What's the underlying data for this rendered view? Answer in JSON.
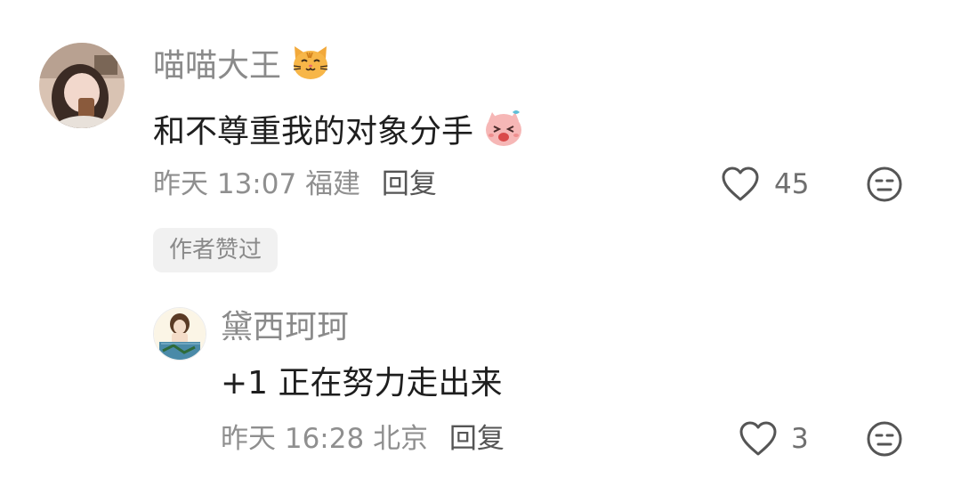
{
  "comment": {
    "username": "喵喵大王",
    "username_emoji": "cat-face-emoji",
    "text": "和不尊重我的对象分手",
    "text_emoji": "crying-face-sticker",
    "time": "昨天 13:07",
    "location": "福建",
    "reply_label": "回复",
    "like_count": "45",
    "author_badge": "作者赞过"
  },
  "reply": {
    "username": "黛西珂珂",
    "text": "+1 正在努力走出来",
    "time": "昨天 16:28",
    "location": "北京",
    "reply_label": "回复",
    "like_count": "3"
  },
  "icons": {
    "like": "heart-outline-icon",
    "dislike": "expressionless-face-icon"
  },
  "colors": {
    "username": "#8a8a8a",
    "text": "#1e1e1e",
    "meta": "#8f8f8f",
    "badge_bg": "#f1f1f1",
    "icon": "#555555"
  }
}
